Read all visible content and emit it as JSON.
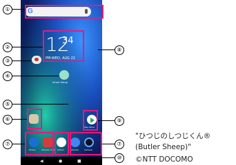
{
  "search": {
    "logo": "G"
  },
  "clock": {
    "hour": "12",
    "minute": "34",
    "date": "PM-WED, AUG 22"
  },
  "assistant_label": "Smart Setup",
  "apps": [
    {
      "label": "Phone",
      "color": "#1a6fd6"
    },
    {
      "label": "docomo mail",
      "color": "#d63b3b"
    },
    {
      "label": "Admin",
      "color": "#2b2b2b"
    },
    {
      "label": "Chrome",
      "color": "#4285F4"
    },
    {
      "label": "Camera",
      "color": "#0f0f1a"
    }
  ],
  "folder_label": "",
  "play_store_label": "Play Store",
  "callouts": [
    "①",
    "②",
    "③",
    "④",
    "⑤",
    "⑥",
    "⑦",
    "⑧",
    "⑨",
    "⑦",
    "⑩"
  ],
  "caption": {
    "line1": "\"ひつじのしつじくん®",
    "line2": "(Butler Sheep)\"",
    "line3": "©NTT DOCOMO"
  },
  "colors": {
    "highlight": "#e8197b"
  }
}
